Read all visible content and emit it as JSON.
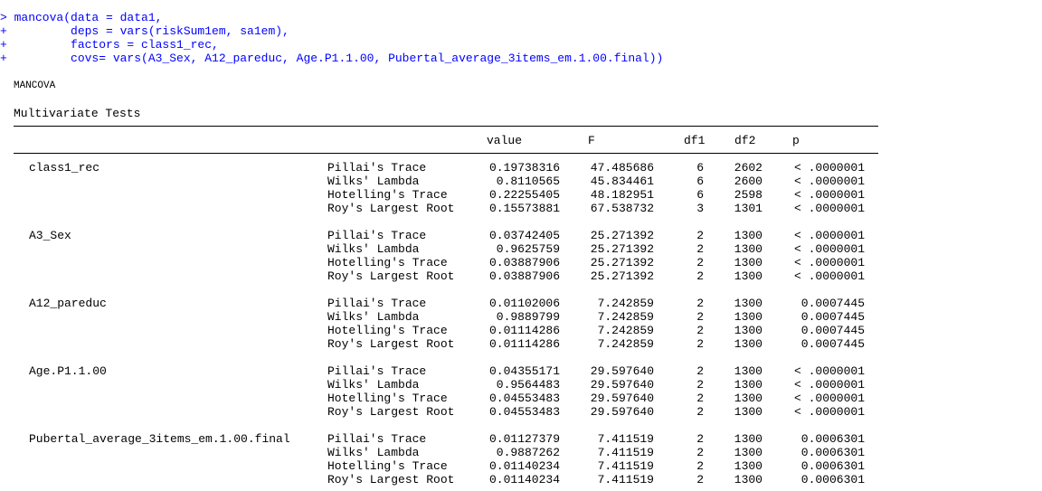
{
  "command": {
    "lines": [
      "> mancova(data = data1,",
      "+         deps = vars(riskSum1em, sa1em),",
      "+         factors = class1_rec,",
      "+         covs= vars(A3_Sex, A12_pareduc, Age.P1.1.00, Pubertal_average_3items_em.1.00.final))"
    ]
  },
  "output": {
    "title": "MANCOVA",
    "table_title": "Multivariate Tests",
    "headers": {
      "value": "value",
      "F": "F",
      "df1": "df1",
      "df2": "df2",
      "p": "p"
    },
    "groups": [
      {
        "term": "class1_rec",
        "rows": [
          {
            "test": "Pillai's Trace",
            "value": "0.19738316",
            "F": "47.485686",
            "df1": "6",
            "df2": "2602",
            "p": "< .0000001"
          },
          {
            "test": "Wilks' Lambda",
            "value": "0.8110565",
            "F": "45.834461",
            "df1": "6",
            "df2": "2600",
            "p": "< .0000001"
          },
          {
            "test": "Hotelling's Trace",
            "value": "0.22255405",
            "F": "48.182951",
            "df1": "6",
            "df2": "2598",
            "p": "< .0000001"
          },
          {
            "test": "Roy's Largest Root",
            "value": "0.15573881",
            "F": "67.538732",
            "df1": "3",
            "df2": "1301",
            "p": "< .0000001"
          }
        ]
      },
      {
        "term": "A3_Sex",
        "rows": [
          {
            "test": "Pillai's Trace",
            "value": "0.03742405",
            "F": "25.271392",
            "df1": "2",
            "df2": "1300",
            "p": "< .0000001"
          },
          {
            "test": "Wilks' Lambda",
            "value": "0.9625759",
            "F": "25.271392",
            "df1": "2",
            "df2": "1300",
            "p": "< .0000001"
          },
          {
            "test": "Hotelling's Trace",
            "value": "0.03887906",
            "F": "25.271392",
            "df1": "2",
            "df2": "1300",
            "p": "< .0000001"
          },
          {
            "test": "Roy's Largest Root",
            "value": "0.03887906",
            "F": "25.271392",
            "df1": "2",
            "df2": "1300",
            "p": "< .0000001"
          }
        ]
      },
      {
        "term": "A12_pareduc",
        "rows": [
          {
            "test": "Pillai's Trace",
            "value": "0.01102006",
            "F": "7.242859",
            "df1": "2",
            "df2": "1300",
            "p": "0.0007445"
          },
          {
            "test": "Wilks' Lambda",
            "value": "0.9889799",
            "F": "7.242859",
            "df1": "2",
            "df2": "1300",
            "p": "0.0007445"
          },
          {
            "test": "Hotelling's Trace",
            "value": "0.01114286",
            "F": "7.242859",
            "df1": "2",
            "df2": "1300",
            "p": "0.0007445"
          },
          {
            "test": "Roy's Largest Root",
            "value": "0.01114286",
            "F": "7.242859",
            "df1": "2",
            "df2": "1300",
            "p": "0.0007445"
          }
        ]
      },
      {
        "term": "Age.P1.1.00",
        "rows": [
          {
            "test": "Pillai's Trace",
            "value": "0.04355171",
            "F": "29.597640",
            "df1": "2",
            "df2": "1300",
            "p": "< .0000001"
          },
          {
            "test": "Wilks' Lambda",
            "value": "0.9564483",
            "F": "29.597640",
            "df1": "2",
            "df2": "1300",
            "p": "< .0000001"
          },
          {
            "test": "Hotelling's Trace",
            "value": "0.04553483",
            "F": "29.597640",
            "df1": "2",
            "df2": "1300",
            "p": "< .0000001"
          },
          {
            "test": "Roy's Largest Root",
            "value": "0.04553483",
            "F": "29.597640",
            "df1": "2",
            "df2": "1300",
            "p": "< .0000001"
          }
        ]
      },
      {
        "term": "Pubertal_average_3items_em.1.00.final",
        "rows": [
          {
            "test": "Pillai's Trace",
            "value": "0.01127379",
            "F": "7.411519",
            "df1": "2",
            "df2": "1300",
            "p": "0.0006301"
          },
          {
            "test": "Wilks' Lambda",
            "value": "0.9887262",
            "F": "7.411519",
            "df1": "2",
            "df2": "1300",
            "p": "0.0006301"
          },
          {
            "test": "Hotelling's Trace",
            "value": "0.01140234",
            "F": "7.411519",
            "df1": "2",
            "df2": "1300",
            "p": "0.0006301"
          },
          {
            "test": "Roy's Largest Root",
            "value": "0.01140234",
            "F": "7.411519",
            "df1": "2",
            "df2": "1300",
            "p": "0.0006301"
          }
        ]
      }
    ]
  },
  "colors": {
    "input_text": "#0000ff",
    "output_text": "#000000",
    "background": "#ffffff"
  }
}
